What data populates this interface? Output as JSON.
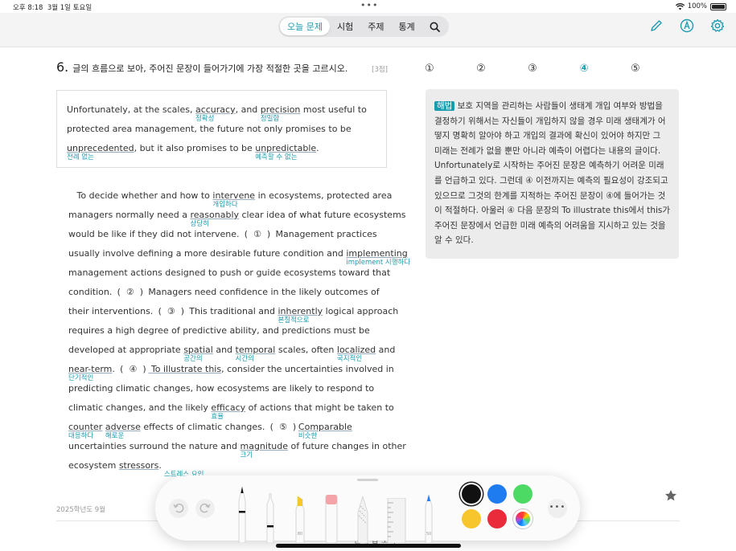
{
  "status_bar": {
    "time": "오후 8:18",
    "date": "3월 1일 토요일",
    "multitask_dots": "•••",
    "battery": "100%"
  },
  "nav": {
    "tabs": [
      {
        "label": "오늘 문제",
        "active": true
      },
      {
        "label": "시험",
        "active": false
      },
      {
        "label": "주제",
        "active": false
      },
      {
        "label": "통계",
        "active": false
      }
    ],
    "search_icon": "search-icon",
    "right_icons": [
      "pencil-icon",
      "markup-icon",
      "gear-icon"
    ],
    "accent_color": "#1a9cb0"
  },
  "question": {
    "number": "6.",
    "prompt": "글의 흐름으로 보아, 주어진 문장이 들어가기에 가장 적절한 곳을 고르시오.",
    "points": "[3점]",
    "choices": [
      "①",
      "②",
      "③",
      "④",
      "⑤"
    ],
    "selected_choice": "④"
  },
  "given_sentence": {
    "l1": {
      "a": "Unfortunately, at the scales, ",
      "w1": "accuracy",
      "g1": "정확성",
      "b": ", and ",
      "w2": "precision",
      "g2": "정밀함",
      "c": " most useful to"
    },
    "l2": {
      "a": "protected area management, the future not only promises to be"
    },
    "l3": {
      "w1": "unprecedented",
      "g1": "전례 없는",
      "a": ", but it also promises to be ",
      "w2": "unpredictable",
      "g2": "예측할 수 없는",
      "b": "."
    }
  },
  "passage": {
    "l1": {
      "a": "To decide whether and how to ",
      "w": "intervene",
      "g": "개입하다",
      "b": " in ecosystems, protected area"
    },
    "l2": {
      "a": "managers normally need a ",
      "w": "reasonably",
      "g": "상당히",
      "b": " clear idea of what future ecosystems"
    },
    "l3": {
      "a": "would be like if they did not intervene. ",
      "blank": "①",
      "b": " Management practices"
    },
    "l4": {
      "a": "usually involve defining a more desirable future condition and ",
      "w": "implementing",
      "g": "implement 시행하다"
    },
    "l5": {
      "a": "management actions designed to push or guide ecosystems toward that"
    },
    "l6": {
      "a": "condition. ",
      "blank": "②",
      "b": " Managers need confidence in the likely outcomes of"
    },
    "l7": {
      "a": "their interventions. ",
      "blank": "③",
      "b": " This traditional and ",
      "w": "inherently",
      "g": "본질적으로",
      "c": " logical approach"
    },
    "l8": {
      "a": "requires a high degree of predictive ability, and predictions must be"
    },
    "l9": {
      "a": "developed at appropriate ",
      "w1": "spatial",
      "g1": "공간의",
      "b": " and ",
      "w2": "temporal",
      "g2": "시간의",
      "c": " scales, often ",
      "w3": "localized",
      "g3": "국지적인",
      "d": " and"
    },
    "l10": {
      "w1": "near-term",
      "g1": "단기적인",
      "a": ". ",
      "blank": "④",
      "b": " To illustrate this",
      "c": ", consider the uncertainties involved in"
    },
    "l11": {
      "a": "predicting climatic changes, how ecosystems are likely to respond to"
    },
    "l12": {
      "a": "climatic changes, and the likely ",
      "w": "efficacy",
      "g": "효율",
      "b": " of actions that might be taken to"
    },
    "l13": {
      "w1": "counter",
      "g1": "대응하다",
      "s": " ",
      "w2": "adverse",
      "g2": "해로운",
      "a": " effects of climatic changes. ",
      "blank": "⑤",
      "w3": "Comparable",
      "g3": "비슷한"
    },
    "l14": {
      "a": "uncertainties surround the nature and ",
      "w": "magnitude",
      "g": "크기",
      "b": " of future changes in other"
    },
    "l15": {
      "a": "ecosystem ",
      "w": "stressors",
      "g": "스트레스 요인",
      "b": "."
    }
  },
  "explanation": {
    "tag": "해법",
    "text": "보호 지역을 관리하는 사람들이 생태계 개입 여부와 방법을 결정하기 위해서는 자신들이 개입하지 않을 경우 미래 생태계가 어떻지 명확히 알아야 하고 개입의 결과에 확신이 있어야 하지만 그 미래는 전례가 없을 뿐만 아니라 예측이 어렵다는 내용의 글이다. Unfortunately로 시작하는 주어진 문장은 예측하기 어려운 미래를 언급하고 있다. 그런데 ④ 이전까지는 예측의 필요성이 강조되고 있으므로 그것의 한계를 지적하는 주어진 문장이 ④에 들어가는 것이 적절하다. 아울러 ④ 다음 문장의 To illustrate this에서 this가 주어진 문장에서 언급한 미래 예측의 어려움을 지시하고 있는 것을 알 수 있다."
  },
  "footer": {
    "year": "2025학년도 9월",
    "behind_toolbar_text": "문제 답 보기"
  },
  "drawing_toolbar": {
    "tools": [
      "pen-tool",
      "fineliner-tool",
      "highlighter-tool",
      "eraser-tool",
      "lasso-tool",
      "ruler-tool",
      "crayon-tool"
    ],
    "tool_labels": {
      "fineliner": "",
      "highlighter": "80",
      "crayon": "50"
    },
    "colors": [
      "#111111",
      "#1e7bf0",
      "#4cd964",
      "#f7c52c",
      "#ea2b3c",
      "color-wheel"
    ],
    "selected_color": "#111111",
    "more_label": "•••"
  }
}
